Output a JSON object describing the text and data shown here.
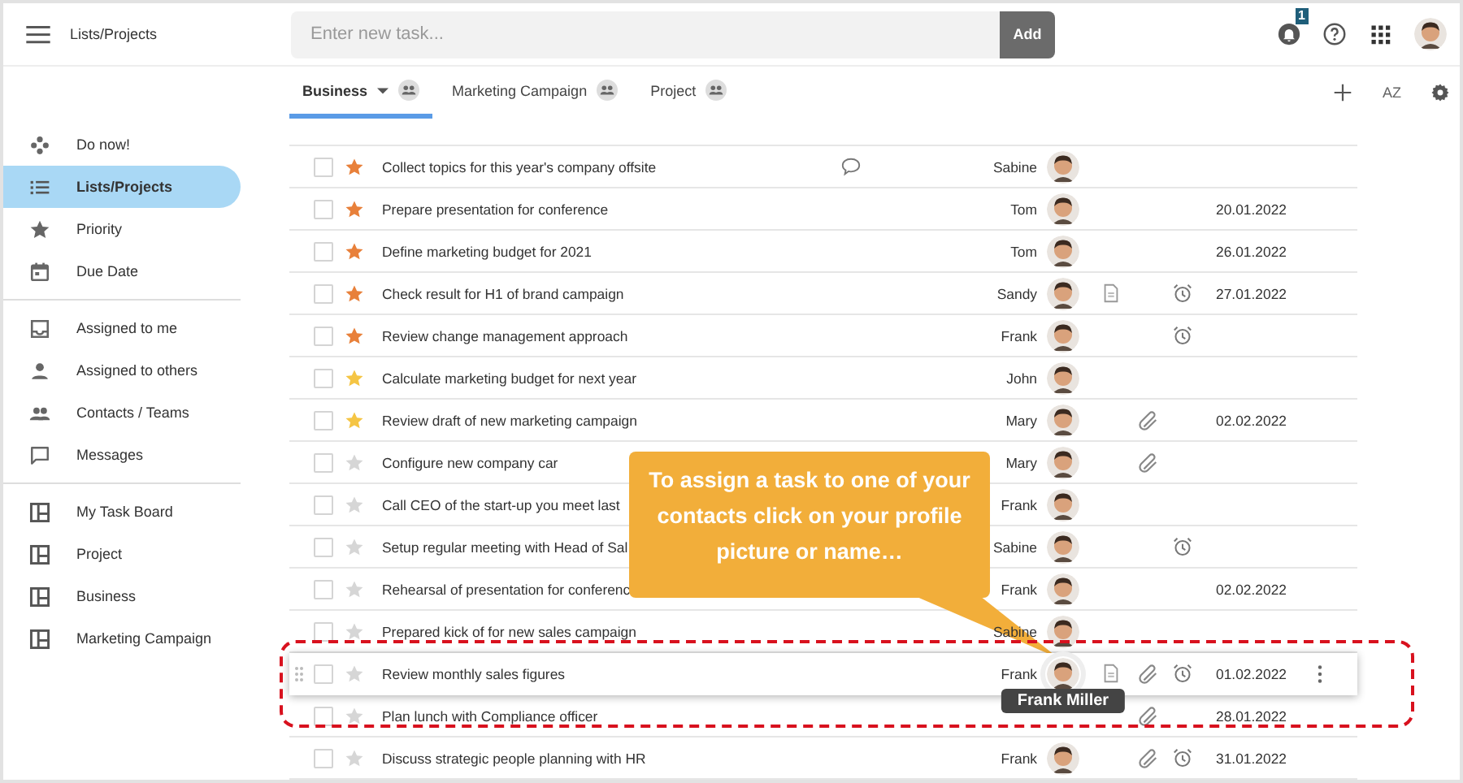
{
  "header": {
    "title": "Lists/Projects",
    "task_input": {
      "placeholder": "Enter new task..."
    },
    "add_button": "Add",
    "notifications_badge": "1"
  },
  "tabs": [
    {
      "label": "Business",
      "selected": true,
      "dropdown": true
    },
    {
      "label": "Marketing Campaign",
      "selected": false,
      "dropdown": false
    },
    {
      "label": "Project",
      "selected": false,
      "dropdown": false
    }
  ],
  "toolbar": {
    "sort_label": "AZ"
  },
  "sidebar": {
    "groups": [
      {
        "items": [
          {
            "label": "Do now!",
            "kind": "gamepad",
            "selected": false
          },
          {
            "label": "Lists/Projects",
            "kind": "list",
            "selected": true
          },
          {
            "label": "Priority",
            "kind": "star",
            "selected": false
          },
          {
            "label": "Due Date",
            "kind": "calendar",
            "selected": false
          }
        ]
      },
      {
        "items": [
          {
            "label": "Assigned to me",
            "kind": "inbox",
            "selected": false
          },
          {
            "label": "Assigned to others",
            "kind": "person",
            "selected": false
          },
          {
            "label": "Contacts / Teams",
            "kind": "people",
            "selected": false
          },
          {
            "label": "Messages",
            "kind": "chat",
            "selected": false
          }
        ]
      },
      {
        "items": [
          {
            "label": "My Task Board",
            "kind": "board",
            "selected": false
          },
          {
            "label": "Project",
            "kind": "board",
            "selected": false
          },
          {
            "label": "Business",
            "kind": "board",
            "selected": false
          },
          {
            "label": "Marketing Campaign",
            "kind": "board",
            "selected": false
          }
        ]
      }
    ]
  },
  "tasks": [
    {
      "title": "Collect topics for this year's company offsite",
      "checked": false,
      "color": "#e8803a",
      "comment": true,
      "assignee": "Sabine",
      "avatar": true,
      "note": false,
      "attachment": false,
      "alarm": false,
      "highlighted": false
    },
    {
      "title": "Prepare presentation for conference",
      "checked": false,
      "color": "#e8803a",
      "comment": false,
      "assignee": "Tom",
      "avatar": true,
      "note": false,
      "attachment": false,
      "alarm": false,
      "due": "20.01.2022",
      "highlighted": false
    },
    {
      "title": "Define marketing budget for 2021",
      "checked": false,
      "color": "#e8803a",
      "comment": false,
      "assignee": "Tom",
      "avatar": true,
      "note": false,
      "attachment": false,
      "alarm": false,
      "due": "26.01.2022",
      "highlighted": false
    },
    {
      "title": "Check result for H1 of brand campaign",
      "checked": false,
      "color": "#e8803a",
      "comment": false,
      "assignee": "Sandy",
      "avatar": true,
      "note": true,
      "attachment": false,
      "alarm": true,
      "due": "27.01.2022",
      "highlighted": false
    },
    {
      "title": "Review change management approach",
      "checked": false,
      "color": "#e8803a",
      "comment": false,
      "assignee": "Frank",
      "avatar": true,
      "note": false,
      "attachment": false,
      "alarm": true,
      "highlighted": false
    },
    {
      "title": "Calculate marketing budget for next year",
      "checked": false,
      "color": "#f5c544",
      "comment": false,
      "assignee": "John",
      "avatar": true,
      "note": false,
      "attachment": false,
      "alarm": false,
      "highlighted": false
    },
    {
      "title": "Review draft of new marketing campaign",
      "checked": false,
      "color": "#f5c544",
      "comment": false,
      "assignee": "Mary",
      "avatar": true,
      "note": false,
      "attachment": true,
      "alarm": false,
      "due": "02.02.2022",
      "highlighted": false
    },
    {
      "title": "Configure new company car",
      "checked": false,
      "color": "#d6d6d6",
      "comment": false,
      "assignee": "Mary",
      "avatar": true,
      "note": false,
      "attachment": true,
      "alarm": false,
      "highlighted": false
    },
    {
      "title": "Call CEO of the start-up you meet last",
      "checked": false,
      "color": "#d6d6d6",
      "comment": false,
      "assignee": "Frank",
      "avatar": true,
      "note": false,
      "attachment": false,
      "alarm": false,
      "highlighted": false
    },
    {
      "title": "Setup regular meeting with Head of Sal",
      "checked": false,
      "color": "#d6d6d6",
      "comment": false,
      "assignee": "Sabine",
      "avatar": true,
      "note": false,
      "attachment": false,
      "alarm": true,
      "highlighted": false
    },
    {
      "title": "Rehearsal of presentation for conferenc",
      "checked": false,
      "color": "#d6d6d6",
      "comment": false,
      "assignee": "Frank",
      "avatar": true,
      "note": false,
      "attachment": false,
      "alarm": false,
      "due": "02.02.2022",
      "highlighted": false
    },
    {
      "title": "Prepared kick of for new sales campaign",
      "checked": false,
      "color": "#d6d6d6",
      "comment": false,
      "assignee": "Sabine",
      "avatar": true,
      "note": false,
      "attachment": false,
      "alarm": false,
      "highlighted": false
    },
    {
      "title": "Review monthly sales figures",
      "checked": false,
      "color": "#d6d6d6",
      "comment": false,
      "assignee": "Frank",
      "avatar": true,
      "note": true,
      "attachment": true,
      "alarm": true,
      "due": "01.02.2022",
      "highlighted": true,
      "tooltip": "Frank Miller"
    },
    {
      "title": "Plan lunch with Compliance officer",
      "checked": false,
      "color": "#d6d6d6",
      "comment": false,
      "avatar": false,
      "note": false,
      "attachment": true,
      "alarm": false,
      "due": "28.01.2022",
      "highlighted": false
    },
    {
      "title": "Discuss strategic people planning with HR",
      "checked": false,
      "color": "#d6d6d6",
      "comment": false,
      "assignee": "Frank",
      "avatar": true,
      "note": false,
      "attachment": true,
      "alarm": true,
      "due": "31.01.2022",
      "highlighted": false
    }
  ],
  "callout": {
    "text": "To assign a task to one of your contacts click on your profile picture or name…"
  }
}
